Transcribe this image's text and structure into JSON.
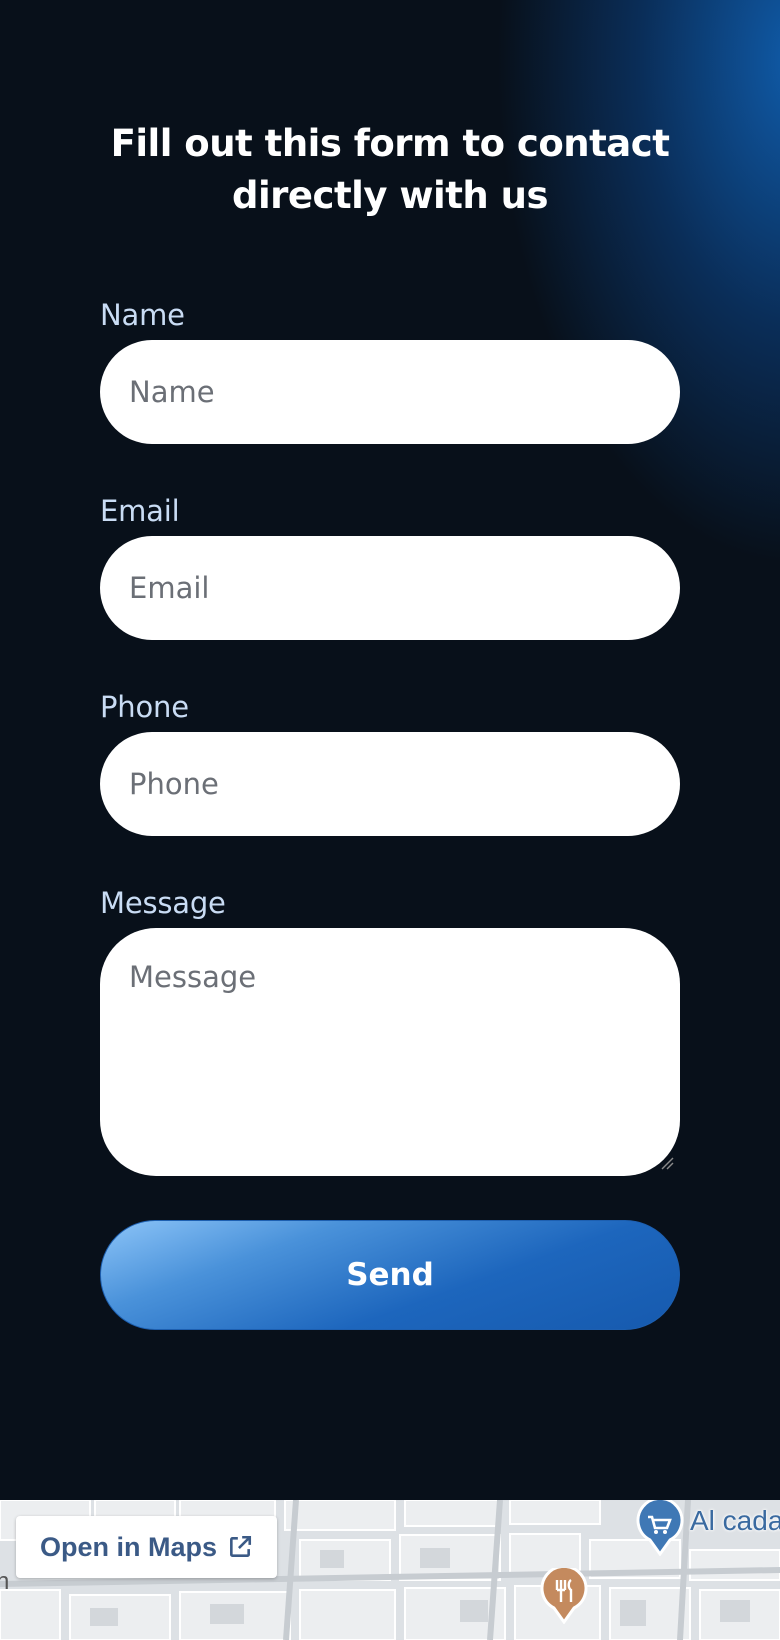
{
  "form": {
    "title": "Fill out this form to contact directly with us",
    "fields": {
      "name": {
        "label": "Name",
        "placeholder": "Name"
      },
      "email": {
        "label": "Email",
        "placeholder": "Email"
      },
      "phone": {
        "label": "Phone",
        "placeholder": "Phone"
      },
      "message": {
        "label": "Message",
        "placeholder": "Message"
      }
    },
    "send_label": "Send"
  },
  "map": {
    "open_in_maps_label": "Open in Maps",
    "place_label": "Al cada",
    "edge_label": "n"
  },
  "colors": {
    "background": "#08101a",
    "accent": "#1d66bd",
    "label": "#c9dcf4",
    "map_link": "#3b5a86"
  },
  "icons": {
    "external_link": "external-link-icon",
    "shopping_cart": "shopping-cart-icon",
    "restaurant": "restaurant-icon"
  }
}
